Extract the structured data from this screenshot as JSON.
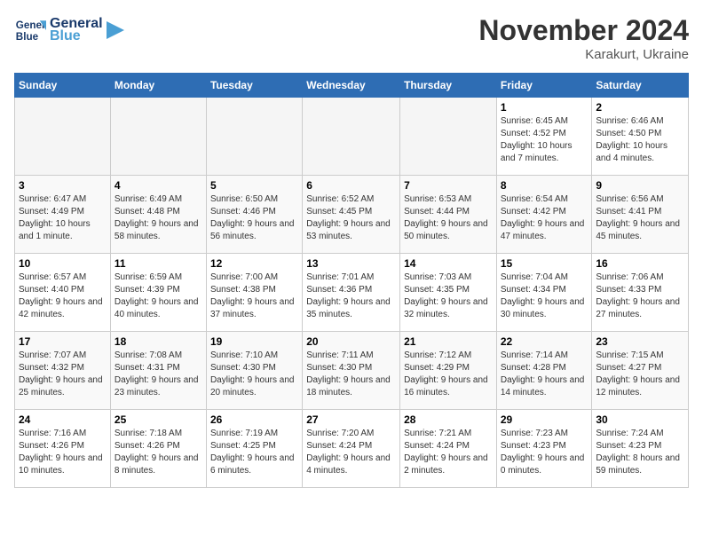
{
  "logo": {
    "line1": "General",
    "line2": "Blue"
  },
  "title": "November 2024",
  "location": "Karakurt, Ukraine",
  "weekdays": [
    "Sunday",
    "Monday",
    "Tuesday",
    "Wednesday",
    "Thursday",
    "Friday",
    "Saturday"
  ],
  "weeks": [
    [
      {
        "day": "",
        "info": ""
      },
      {
        "day": "",
        "info": ""
      },
      {
        "day": "",
        "info": ""
      },
      {
        "day": "",
        "info": ""
      },
      {
        "day": "",
        "info": ""
      },
      {
        "day": "1",
        "info": "Sunrise: 6:45 AM\nSunset: 4:52 PM\nDaylight: 10 hours and 7 minutes."
      },
      {
        "day": "2",
        "info": "Sunrise: 6:46 AM\nSunset: 4:50 PM\nDaylight: 10 hours and 4 minutes."
      }
    ],
    [
      {
        "day": "3",
        "info": "Sunrise: 6:47 AM\nSunset: 4:49 PM\nDaylight: 10 hours and 1 minute."
      },
      {
        "day": "4",
        "info": "Sunrise: 6:49 AM\nSunset: 4:48 PM\nDaylight: 9 hours and 58 minutes."
      },
      {
        "day": "5",
        "info": "Sunrise: 6:50 AM\nSunset: 4:46 PM\nDaylight: 9 hours and 56 minutes."
      },
      {
        "day": "6",
        "info": "Sunrise: 6:52 AM\nSunset: 4:45 PM\nDaylight: 9 hours and 53 minutes."
      },
      {
        "day": "7",
        "info": "Sunrise: 6:53 AM\nSunset: 4:44 PM\nDaylight: 9 hours and 50 minutes."
      },
      {
        "day": "8",
        "info": "Sunrise: 6:54 AM\nSunset: 4:42 PM\nDaylight: 9 hours and 47 minutes."
      },
      {
        "day": "9",
        "info": "Sunrise: 6:56 AM\nSunset: 4:41 PM\nDaylight: 9 hours and 45 minutes."
      }
    ],
    [
      {
        "day": "10",
        "info": "Sunrise: 6:57 AM\nSunset: 4:40 PM\nDaylight: 9 hours and 42 minutes."
      },
      {
        "day": "11",
        "info": "Sunrise: 6:59 AM\nSunset: 4:39 PM\nDaylight: 9 hours and 40 minutes."
      },
      {
        "day": "12",
        "info": "Sunrise: 7:00 AM\nSunset: 4:38 PM\nDaylight: 9 hours and 37 minutes."
      },
      {
        "day": "13",
        "info": "Sunrise: 7:01 AM\nSunset: 4:36 PM\nDaylight: 9 hours and 35 minutes."
      },
      {
        "day": "14",
        "info": "Sunrise: 7:03 AM\nSunset: 4:35 PM\nDaylight: 9 hours and 32 minutes."
      },
      {
        "day": "15",
        "info": "Sunrise: 7:04 AM\nSunset: 4:34 PM\nDaylight: 9 hours and 30 minutes."
      },
      {
        "day": "16",
        "info": "Sunrise: 7:06 AM\nSunset: 4:33 PM\nDaylight: 9 hours and 27 minutes."
      }
    ],
    [
      {
        "day": "17",
        "info": "Sunrise: 7:07 AM\nSunset: 4:32 PM\nDaylight: 9 hours and 25 minutes."
      },
      {
        "day": "18",
        "info": "Sunrise: 7:08 AM\nSunset: 4:31 PM\nDaylight: 9 hours and 23 minutes."
      },
      {
        "day": "19",
        "info": "Sunrise: 7:10 AM\nSunset: 4:30 PM\nDaylight: 9 hours and 20 minutes."
      },
      {
        "day": "20",
        "info": "Sunrise: 7:11 AM\nSunset: 4:30 PM\nDaylight: 9 hours and 18 minutes."
      },
      {
        "day": "21",
        "info": "Sunrise: 7:12 AM\nSunset: 4:29 PM\nDaylight: 9 hours and 16 minutes."
      },
      {
        "day": "22",
        "info": "Sunrise: 7:14 AM\nSunset: 4:28 PM\nDaylight: 9 hours and 14 minutes."
      },
      {
        "day": "23",
        "info": "Sunrise: 7:15 AM\nSunset: 4:27 PM\nDaylight: 9 hours and 12 minutes."
      }
    ],
    [
      {
        "day": "24",
        "info": "Sunrise: 7:16 AM\nSunset: 4:26 PM\nDaylight: 9 hours and 10 minutes."
      },
      {
        "day": "25",
        "info": "Sunrise: 7:18 AM\nSunset: 4:26 PM\nDaylight: 9 hours and 8 minutes."
      },
      {
        "day": "26",
        "info": "Sunrise: 7:19 AM\nSunset: 4:25 PM\nDaylight: 9 hours and 6 minutes."
      },
      {
        "day": "27",
        "info": "Sunrise: 7:20 AM\nSunset: 4:24 PM\nDaylight: 9 hours and 4 minutes."
      },
      {
        "day": "28",
        "info": "Sunrise: 7:21 AM\nSunset: 4:24 PM\nDaylight: 9 hours and 2 minutes."
      },
      {
        "day": "29",
        "info": "Sunrise: 7:23 AM\nSunset: 4:23 PM\nDaylight: 9 hours and 0 minutes."
      },
      {
        "day": "30",
        "info": "Sunrise: 7:24 AM\nSunset: 4:23 PM\nDaylight: 8 hours and 59 minutes."
      }
    ]
  ]
}
